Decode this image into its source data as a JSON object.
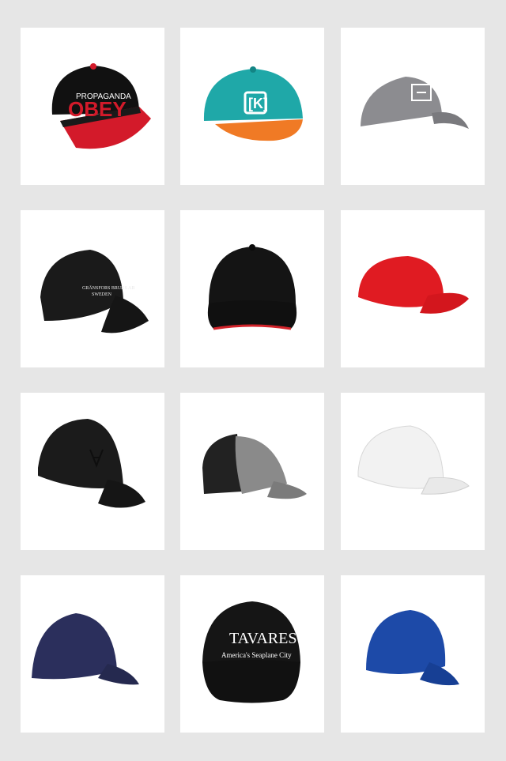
{
  "products": [
    {
      "id": "obey",
      "icon": "obey-snapback-cap",
      "colors": {
        "crown": "#111111",
        "brim": "#d31a2a",
        "logo": "#d31a2a"
      },
      "logo_top": "PROPAGANDA",
      "logo_main": "OBEY"
    },
    {
      "id": "kr3w",
      "icon": "teal-orange-snapback-cap",
      "colors": {
        "crown": "#1fa8a8",
        "brim": "#f07a25",
        "logo": "#ffffff"
      },
      "logo_main": "[K]"
    },
    {
      "id": "grey-tactical",
      "icon": "grey-baseball-cap",
      "colors": {
        "crown": "#8c8c90",
        "brim": "#7a7a7e"
      }
    },
    {
      "id": "sweden",
      "icon": "black-embroidered-cap",
      "colors": {
        "crown": "#1a1a1a",
        "brim": "#151515"
      },
      "logo_line1": "GRÄNSFORS BRUKS AB",
      "logo_line2": "SWEDEN"
    },
    {
      "id": "black-sandwich",
      "icon": "black-sandwich-brim-cap",
      "colors": {
        "crown": "#141414",
        "brim": "#101010",
        "trim": "#d2232a"
      }
    },
    {
      "id": "red-plain",
      "icon": "red-baseball-cap",
      "colors": {
        "crown": "#e01b22",
        "brim": "#d3161d"
      }
    },
    {
      "id": "black-watchdogs",
      "icon": "black-fitted-cap",
      "colors": {
        "crown": "#1b1b1b",
        "brim": "#151515"
      }
    },
    {
      "id": "grey-trucker",
      "icon": "grey-trucker-cap",
      "colors": {
        "crown": "#8a8a8a",
        "brim": "#7b7b7b",
        "mesh": "#222222"
      }
    },
    {
      "id": "white-plain",
      "icon": "white-baseball-cap",
      "colors": {
        "crown": "#f2f2f2",
        "brim": "#e9e9e9"
      }
    },
    {
      "id": "navy-plain",
      "icon": "navy-baseball-cap",
      "colors": {
        "crown": "#2b2f5c",
        "brim": "#25294f"
      }
    },
    {
      "id": "tavares",
      "icon": "black-tavares-cap",
      "colors": {
        "crown": "#151515",
        "brim": "#111111",
        "logo": "#ffffff"
      },
      "logo_main": "TAVARES",
      "logo_sub": "America's Seaplane City"
    },
    {
      "id": "royal-blue",
      "icon": "royal-blue-baseball-cap",
      "colors": {
        "crown": "#1d4aa8",
        "brim": "#173f94"
      }
    }
  ]
}
